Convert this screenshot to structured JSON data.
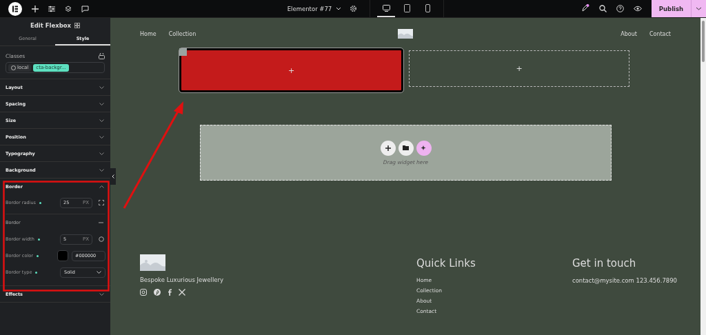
{
  "topbar": {
    "document": "Elementor #77",
    "devices": [
      {
        "kind": "desktop",
        "selected": true
      },
      {
        "kind": "tablet",
        "selected": false
      },
      {
        "kind": "mobile",
        "selected": false
      }
    ],
    "publish": "Publish",
    "notification": true
  },
  "panel": {
    "title": "Edit Flexbox",
    "tabs": [
      {
        "label": "General",
        "selected": false
      },
      {
        "label": "Style",
        "selected": true
      }
    ],
    "classes_label": "Classes",
    "chips": [
      {
        "kind": "local",
        "label": "local"
      },
      {
        "kind": "class",
        "label": "cta-backgr..."
      }
    ],
    "sections": [
      {
        "label": "Layout",
        "expanded": false
      },
      {
        "label": "Spacing",
        "expanded": false
      },
      {
        "label": "Size",
        "expanded": false
      },
      {
        "label": "Position",
        "expanded": false
      },
      {
        "label": "Typography",
        "expanded": false
      },
      {
        "label": "Background",
        "expanded": false
      },
      {
        "label": "Border",
        "expanded": true,
        "controls": [
          {
            "kind": "number",
            "label": "Border radius",
            "value": "25",
            "unit": "PX",
            "tool": {
              "kind": "corners"
            }
          },
          {
            "kind": "heading",
            "label": "Border"
          },
          {
            "kind": "number",
            "label": "Border width",
            "value": "5",
            "unit": "PX",
            "tool": {
              "kind": "sides"
            }
          },
          {
            "kind": "color",
            "label": "Border color",
            "value": "#000000",
            "color": "#000000"
          },
          {
            "kind": "select",
            "label": "Border type",
            "value": "Solid"
          }
        ]
      },
      {
        "label": "Effects",
        "expanded": false
      }
    ]
  },
  "canvas": {
    "containers": [
      {
        "selected": true,
        "add": "+"
      },
      {
        "selected": false,
        "add": "+"
      }
    ],
    "nav_left": [
      "Home",
      "Collection"
    ],
    "nav_right": [
      "About",
      "Contact"
    ],
    "drop_hint": "Drag widget here",
    "footer": {
      "tagline": "Bespoke Luxurious Jewellery",
      "links_title": "Quick Links",
      "links": [
        "Home",
        "Collection",
        "About",
        "Contact"
      ],
      "contact_title": "Get in touch",
      "contact": "contact@mysite.com 123.456.7890"
    }
  }
}
